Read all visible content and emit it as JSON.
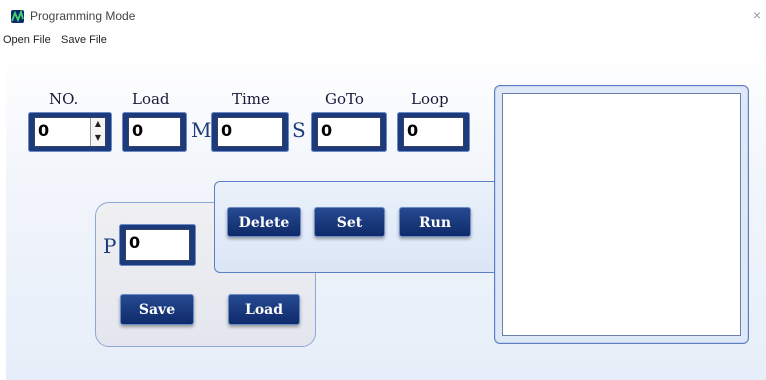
{
  "window": {
    "title": "Programming Mode",
    "close_glyph": "×",
    "icon": "app-logo-icon"
  },
  "menu": {
    "items": [
      "Open File",
      "Save File"
    ]
  },
  "params": {
    "no": {
      "label": "NO.",
      "value": "0"
    },
    "load": {
      "label": "Load",
      "value": "0",
      "unit": "M"
    },
    "time": {
      "label": "Time",
      "value": "0",
      "unit": "S"
    },
    "goto": {
      "label": "GoTo",
      "value": "0"
    },
    "loop": {
      "label": "Loop",
      "value": "0"
    }
  },
  "spinner": {
    "up": "▲",
    "down": "▼"
  },
  "program": {
    "p_label": "P",
    "p_value": "0",
    "save_label": "Save",
    "load_label": "Load"
  },
  "actions": {
    "delete_label": "Delete",
    "set_label": "Set",
    "run_label": "Run"
  },
  "colors": {
    "accent": "#1d3a7a",
    "button": "#0e2a6a",
    "panel_border": "#5c7ec4"
  }
}
